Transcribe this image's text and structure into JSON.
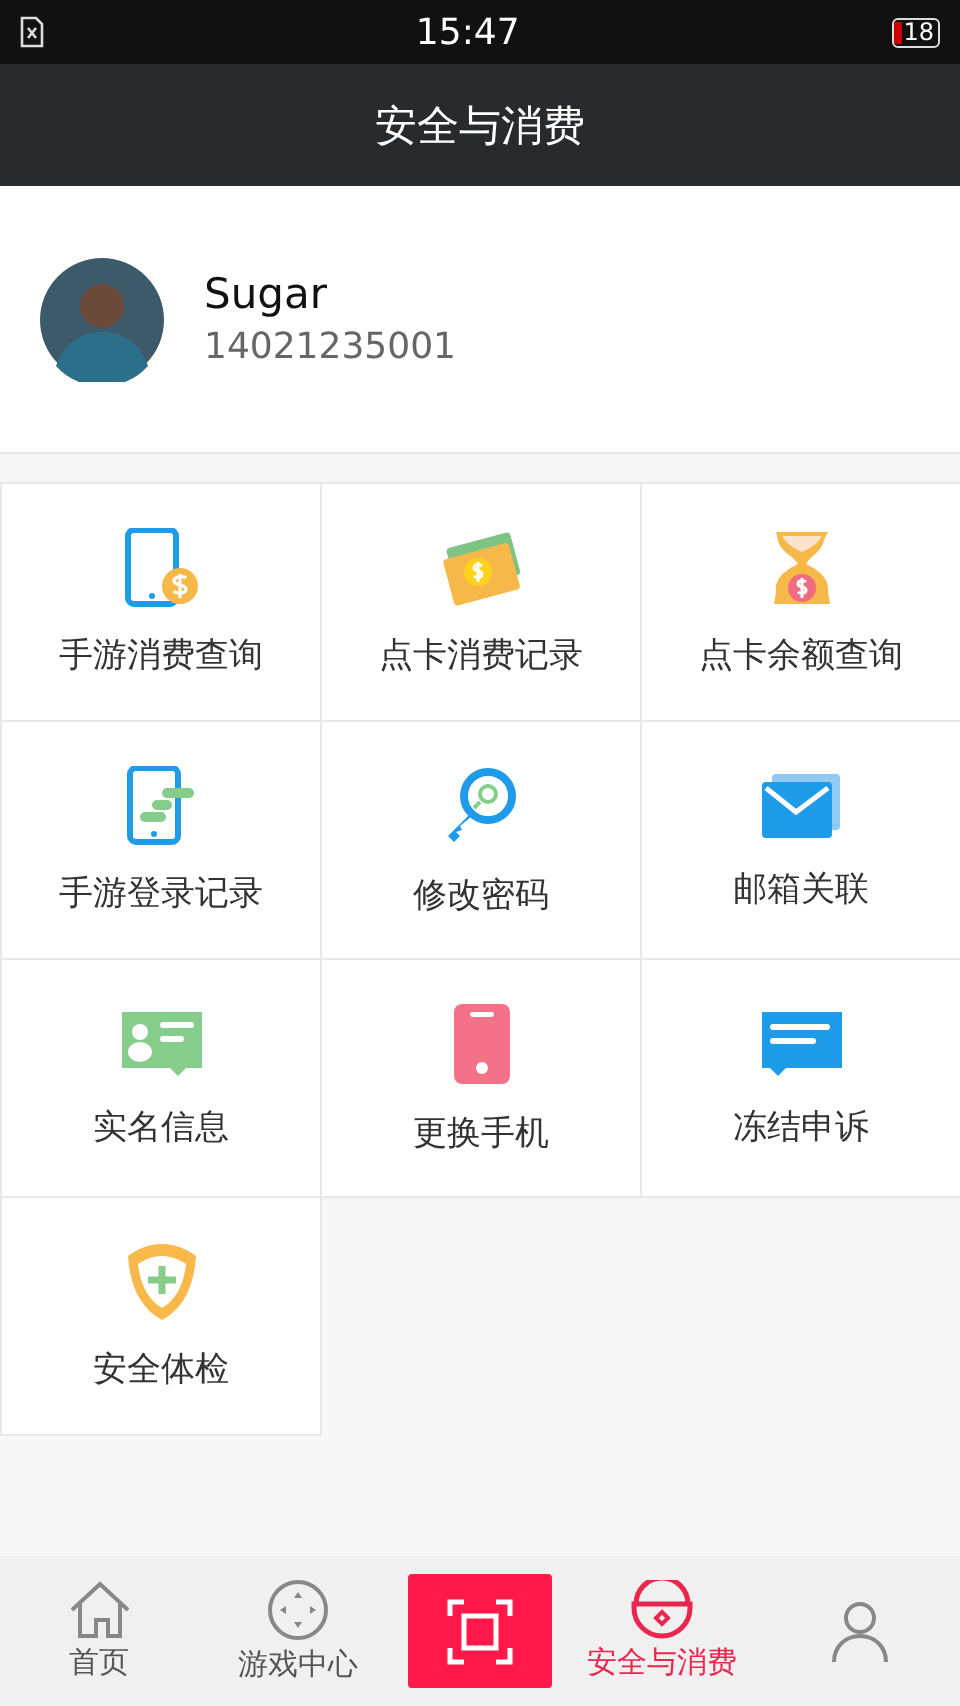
{
  "status_bar": {
    "time": "15:47",
    "battery": "18"
  },
  "header": {
    "title": "安全与消费"
  },
  "profile": {
    "name": "Sugar",
    "phone": "14021235001"
  },
  "tiles": [
    {
      "kind": "phone-coin",
      "label": "手游消费查询"
    },
    {
      "kind": "card-coin",
      "label": "点卡消费记录"
    },
    {
      "kind": "hourglass",
      "label": "点卡余额查询"
    },
    {
      "kind": "phone-log",
      "label": "手游登录记录"
    },
    {
      "kind": "key",
      "label": "修改密码"
    },
    {
      "kind": "mail",
      "label": "邮箱关联"
    },
    {
      "kind": "id-card",
      "label": "实名信息"
    },
    {
      "kind": "phone",
      "label": "更换手机"
    },
    {
      "kind": "message",
      "label": "冻结申诉"
    },
    {
      "kind": "shield",
      "label": "安全体检"
    }
  ],
  "tab_bar": [
    {
      "kind": "home",
      "label": "首页",
      "selected": false
    },
    {
      "kind": "gamepad",
      "label": "游戏中心",
      "selected": false
    },
    {
      "kind": "scan"
    },
    {
      "kind": "lock",
      "label": "安全与消费",
      "selected": true
    },
    {
      "kind": "person",
      "selected": false
    }
  ]
}
